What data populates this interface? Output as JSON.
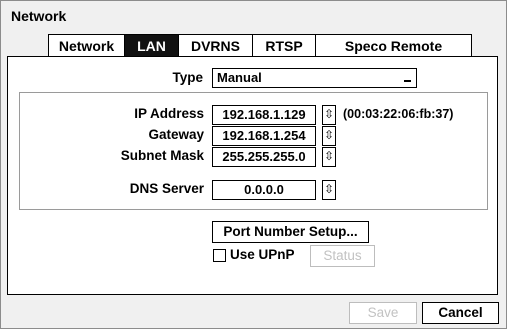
{
  "window": {
    "title": "Network"
  },
  "tabs": [
    {
      "label": "Network",
      "active": false
    },
    {
      "label": "LAN",
      "active": true
    },
    {
      "label": "DVRNS",
      "active": false
    },
    {
      "label": "RTSP",
      "active": false
    },
    {
      "label": "Speco Remote",
      "active": false
    }
  ],
  "type": {
    "label": "Type",
    "value": "Manual",
    "icon": "dropdown-arrow-icon"
  },
  "ip": {
    "label": "IP Address",
    "value": "192.168.1.129",
    "mac": "(00:03:22:06:fb:37)"
  },
  "gateway": {
    "label": "Gateway",
    "value": "192.168.1.254"
  },
  "subnet": {
    "label": "Subnet Mask",
    "value": "255.255.255.0"
  },
  "dns": {
    "label": "DNS Server",
    "value": "0.0.0.0"
  },
  "port_setup": {
    "label": "Port Number Setup..."
  },
  "upnp": {
    "label": "Use UPnP",
    "checked": false,
    "status_label": "Status"
  },
  "footer": {
    "save_label": "Save",
    "cancel_label": "Cancel"
  },
  "spinner_glyph": "⇳"
}
